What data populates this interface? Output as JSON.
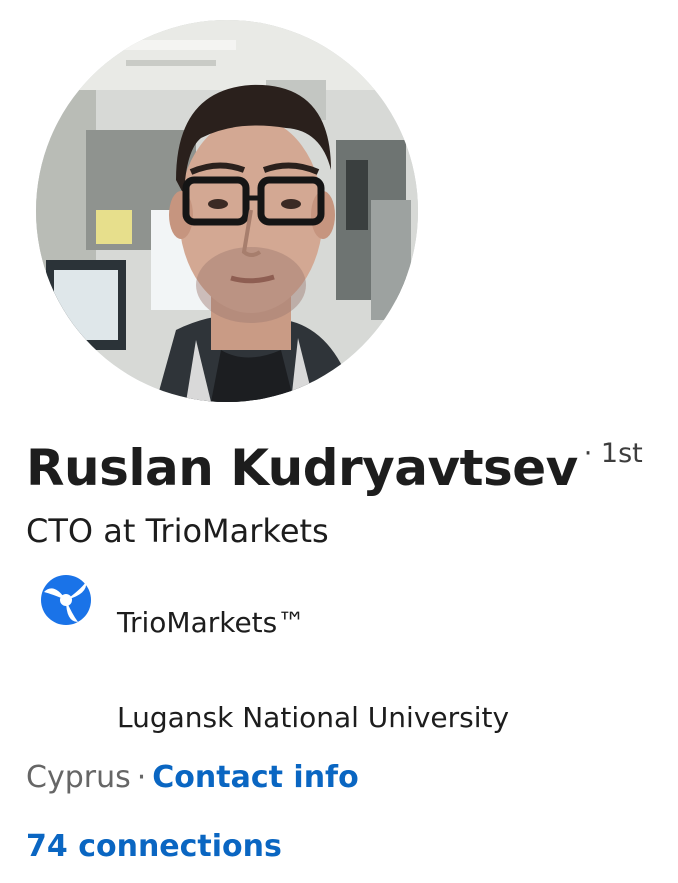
{
  "profile": {
    "name": "Ruslan Kudryavtsev",
    "degree": "· 1st",
    "headline": "CTO at TrioMarkets",
    "company": "TrioMarkets™",
    "school": "Lugansk National University",
    "location": "Cyprus",
    "separator": "·",
    "contact_info_label": "Contact info",
    "connections_label": "74 connections"
  },
  "icons": {
    "company_logo": "triomarkets-logo-icon"
  },
  "colors": {
    "link": "#0a66c2",
    "logo": "#1a73e8",
    "text": "#1d1d1d",
    "muted": "#666666"
  }
}
